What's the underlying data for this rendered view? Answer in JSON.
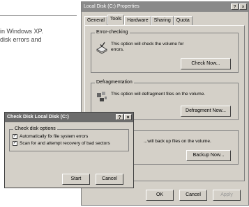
{
  "background": {
    "line1": "in Windows XP.",
    "line2": "disk errors and"
  },
  "properties_window": {
    "title": "Local Disk (C:) Properties",
    "title_buttons": [
      "?",
      "×"
    ],
    "tabs": [
      "General",
      "Tools",
      "Hardware",
      "Sharing",
      "Quota"
    ],
    "active_tab": "Tools",
    "error_checking": {
      "label": "Error-checking",
      "text": "This option will check the volume for errors.",
      "button": "Check Now..."
    },
    "defragmentation": {
      "label": "Defragmentation",
      "text": "This option will defragment files on the volume.",
      "button": "Defragment Now..."
    },
    "backup": {
      "text": "...will back up files on the volume.",
      "button": "Backup Now..."
    },
    "buttons": {
      "ok": "OK",
      "cancel": "Cancel",
      "apply": "Apply"
    }
  },
  "check_disk_dialog": {
    "title": "Check Disk Local Disk (C:)",
    "title_buttons": [
      "?",
      "×"
    ],
    "group_label": "Check disk options",
    "options": [
      {
        "label": "Automatically fix file system errors",
        "checked": true
      },
      {
        "label": "Scan for and attempt recovery of bad sectors",
        "checked": true
      }
    ],
    "buttons": {
      "start": "Start",
      "cancel": "Cancel"
    }
  }
}
